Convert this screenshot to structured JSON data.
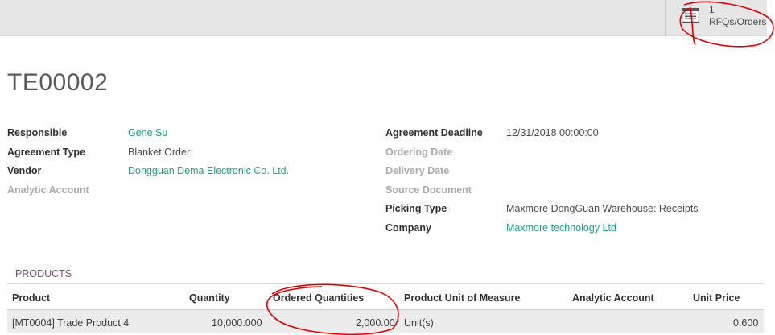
{
  "header": {
    "smart_button": {
      "count": "1",
      "label": "RFQs/Orders"
    }
  },
  "record": {
    "title": "TE00002"
  },
  "fields_left": [
    {
      "label": "Responsible",
      "value": "Gene Su"
    },
    {
      "label": "Agreement Type",
      "value": "Blanket Order"
    },
    {
      "label": "Vendor",
      "value": "Dongguan Dema Electronic Co. Ltd."
    },
    {
      "label": "Analytic Account",
      "value": ""
    }
  ],
  "fields_right": [
    {
      "label": "Agreement Deadline",
      "value": "12/31/2018 00:00:00"
    },
    {
      "label": "Ordering Date",
      "value": ""
    },
    {
      "label": "Delivery Date",
      "value": ""
    },
    {
      "label": "Source Document",
      "value": ""
    },
    {
      "label": "Picking Type",
      "value": "Maxmore DongGuan Warehouse: Receipts"
    },
    {
      "label": "Company",
      "value": "Maxmore technology Ltd"
    }
  ],
  "tabs": [
    {
      "label": "PRODUCTS"
    }
  ],
  "products_table": {
    "columns": [
      "Product",
      "Quantity",
      "Ordered Quantities",
      "Product Unit of Measure",
      "Analytic Account",
      "Unit Price"
    ],
    "rows": [
      [
        "[MT0004] Trade Product 4",
        "10,000.000",
        "2,000.00",
        "Unit(s)",
        "",
        "0.600"
      ]
    ]
  },
  "colors": {
    "link": "#21a08b",
    "tab_accent": "#7c4a79",
    "annotation": "#e00000"
  }
}
